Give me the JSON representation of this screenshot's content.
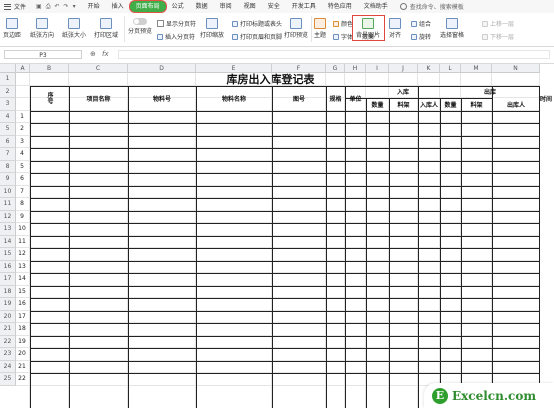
{
  "menubar": {
    "file_label": "文件",
    "tabs": [
      {
        "label": "开始",
        "active": false
      },
      {
        "label": "插入",
        "active": false
      },
      {
        "label": "页面布局",
        "active": true
      },
      {
        "label": "公式",
        "active": false
      },
      {
        "label": "数据",
        "active": false
      },
      {
        "label": "审阅",
        "active": false
      },
      {
        "label": "视图",
        "active": false
      },
      {
        "label": "安全",
        "active": false
      },
      {
        "label": "开发工具",
        "active": false
      },
      {
        "label": "特色应用",
        "active": false
      },
      {
        "label": "文档助手",
        "active": false
      }
    ],
    "search_placeholder": "查找命令、搜索模板",
    "active_tab_color": "#3fae49"
  },
  "ribbon": {
    "page_margin": "页边距",
    "orientation": "纸张方向",
    "paper_size": "纸张大小",
    "print_area": "打印区域",
    "page_break_preview": "分页预览",
    "show_page_breaks": "显示分页符",
    "insert_page_break": "插入分页符",
    "print_scale": "打印缩放",
    "print_titles": "打印标题或表头",
    "print_header_footer": "打印页眉和页脚",
    "print_preview": "打印预览",
    "theme": "主题",
    "colors": "颜色",
    "fonts": "字体",
    "effects": "效果",
    "background_image": "背景图片",
    "align": "对齐",
    "group": "组合",
    "rotate": "旋转",
    "selection_pane": "选择窗格",
    "bring_forward": "上移一层",
    "send_backward": "下移一层",
    "highlight_color": "#e0473e"
  },
  "formula_bar": {
    "cell_ref": "P3",
    "fx_symbol": "fx",
    "zoom_symbol": "⊕"
  },
  "sheet": {
    "columns": [
      "A",
      "B",
      "C",
      "D",
      "E",
      "F",
      "G",
      "H",
      "I",
      "J",
      "K",
      "L",
      "M",
      "N"
    ],
    "row_numbers": [
      "1",
      "2",
      "3",
      "4",
      "5",
      "6",
      "7",
      "8",
      "9",
      "10",
      "11",
      "12",
      "13",
      "14",
      "15",
      "16",
      "17",
      "18",
      "19",
      "20",
      "21",
      "22",
      "23",
      "24",
      "25"
    ]
  },
  "table": {
    "title": "库房出入库登记表",
    "seq_header": "序号",
    "project_name": "项目名称",
    "material_no": "物料号",
    "material_name": "物料名称",
    "drawing_no": "图号",
    "spec": "规格",
    "unit": "单位",
    "inbound": "入库",
    "outbound": "出库",
    "qty": "数量",
    "rack": "料架",
    "receiver": "入库人",
    "qty2": "数量",
    "rack2": "料架",
    "issuer": "出库人",
    "time": "时间",
    "serials": [
      "1",
      "2",
      "3",
      "4",
      "5",
      "6",
      "7",
      "8",
      "9",
      "10",
      "11",
      "12",
      "13",
      "14",
      "15",
      "16",
      "17",
      "18",
      "19",
      "20",
      "21",
      "22"
    ]
  },
  "watermark": {
    "logo_letter": "E",
    "text": "Excelcn.com"
  }
}
